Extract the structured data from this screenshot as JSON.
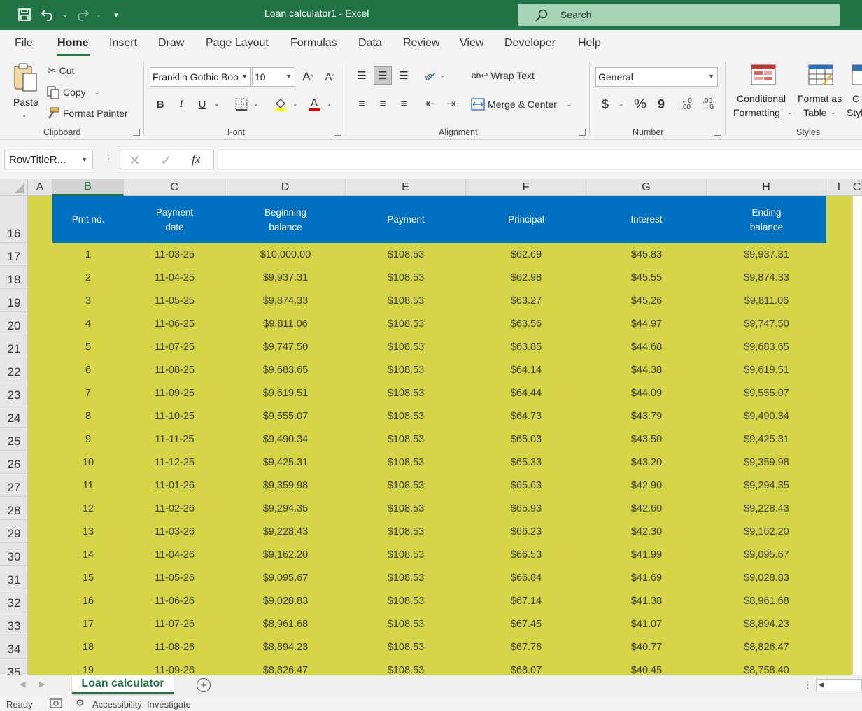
{
  "titlebar": {
    "title": "Loan calculator1  -  Excel",
    "search_placeholder": "Search",
    "accent": "#217346"
  },
  "tabs": [
    "File",
    "Home",
    "Insert",
    "Draw",
    "Page Layout",
    "Formulas",
    "Data",
    "Review",
    "View",
    "Developer",
    "Help"
  ],
  "active_tab": "Home",
  "ribbon": {
    "clipboard": {
      "label": "Clipboard",
      "paste": "Paste",
      "cut": "Cut",
      "copy": "Copy",
      "format_painter": "Format Painter"
    },
    "font": {
      "label": "Font",
      "font_name": "Franklin Gothic Boo",
      "font_size": "10",
      "bold": "B",
      "italic": "I",
      "underline": "U"
    },
    "alignment": {
      "label": "Alignment",
      "wrap_text": "Wrap Text",
      "merge_center": "Merge & Center"
    },
    "number": {
      "label": "Number",
      "format": "General",
      "currency": "$",
      "percent": "%",
      "comma": "9"
    },
    "styles": {
      "label": "Styles",
      "conditional_formatting_1": "Conditional",
      "conditional_formatting_2": "Formatting",
      "format_table_1": "Format as",
      "format_table_2": "Table",
      "cell_styles_1": "C",
      "cell_styles_2": "Styl"
    }
  },
  "formula_bar": {
    "name_box": "RowTitleR...",
    "fx": "fx",
    "formula": ""
  },
  "columns": [
    "A",
    "B",
    "C",
    "D",
    "E",
    "F",
    "G",
    "H",
    "I",
    "C"
  ],
  "selected_column": "B",
  "rows": [
    "16",
    "17",
    "18",
    "19",
    "20",
    "21",
    "22",
    "23",
    "24",
    "25",
    "26",
    "27",
    "28",
    "29",
    "30",
    "31",
    "32",
    "33",
    "34",
    "35"
  ],
  "table_header": {
    "pmt_no": "Pmt no.",
    "payment_date": "Payment\ndate",
    "beginning_balance": "Beginning\nbalance",
    "payment": "Payment",
    "principal": "Principal",
    "interest": "Interest",
    "ending_balance": "Ending\nbalance"
  },
  "table_rows": [
    [
      "1",
      "11-03-25",
      "$10,000.00",
      "$108.53",
      "$62.69",
      "$45.83",
      "$9,937.31"
    ],
    [
      "2",
      "11-04-25",
      "$9,937.31",
      "$108.53",
      "$62.98",
      "$45.55",
      "$9,874.33"
    ],
    [
      "3",
      "11-05-25",
      "$9,874.33",
      "$108.53",
      "$63.27",
      "$45.26",
      "$9,811.06"
    ],
    [
      "4",
      "11-06-25",
      "$9,811.06",
      "$108.53",
      "$63.56",
      "$44.97",
      "$9,747.50"
    ],
    [
      "5",
      "11-07-25",
      "$9,747.50",
      "$108.53",
      "$63.85",
      "$44.68",
      "$9,683.65"
    ],
    [
      "6",
      "11-08-25",
      "$9,683.65",
      "$108.53",
      "$64.14",
      "$44.38",
      "$9,619.51"
    ],
    [
      "7",
      "11-09-25",
      "$9,619.51",
      "$108.53",
      "$64.44",
      "$44.09",
      "$9,555.07"
    ],
    [
      "8",
      "11-10-25",
      "$9,555.07",
      "$108.53",
      "$64.73",
      "$43.79",
      "$9,490.34"
    ],
    [
      "9",
      "11-11-25",
      "$9,490.34",
      "$108.53",
      "$65.03",
      "$43.50",
      "$9,425.31"
    ],
    [
      "10",
      "11-12-25",
      "$9,425.31",
      "$108.53",
      "$65.33",
      "$43.20",
      "$9,359.98"
    ],
    [
      "11",
      "11-01-26",
      "$9,359.98",
      "$108.53",
      "$65.63",
      "$42.90",
      "$9,294.35"
    ],
    [
      "12",
      "11-02-26",
      "$9,294.35",
      "$108.53",
      "$65.93",
      "$42.60",
      "$9,228.43"
    ],
    [
      "13",
      "11-03-26",
      "$9,228.43",
      "$108.53",
      "$66.23",
      "$42.30",
      "$9,162.20"
    ],
    [
      "14",
      "11-04-26",
      "$9,162.20",
      "$108.53",
      "$66.53",
      "$41.99",
      "$9,095.67"
    ],
    [
      "15",
      "11-05-26",
      "$9,095.67",
      "$108.53",
      "$66.84",
      "$41.69",
      "$9,028.83"
    ],
    [
      "16",
      "11-06-26",
      "$9,028.83",
      "$108.53",
      "$67.14",
      "$41.38",
      "$8,961.68"
    ],
    [
      "17",
      "11-07-26",
      "$8,961.68",
      "$108.53",
      "$67.45",
      "$41.07",
      "$8,894.23"
    ],
    [
      "18",
      "11-08-26",
      "$8,894.23",
      "$108.53",
      "$67.76",
      "$40.77",
      "$8,826.47"
    ],
    [
      "19",
      "11-09-26",
      "$8,826.47",
      "$108.53",
      "$68.07",
      "$40.45",
      "$8,758.40"
    ]
  ],
  "sheet_tab": "Loan calculator",
  "status": {
    "ready": "Ready",
    "accessibility": "Accessibility: Investigate"
  },
  "colors": {
    "header_blue": "#0070c0",
    "sheet_fill": "#d6d547"
  }
}
